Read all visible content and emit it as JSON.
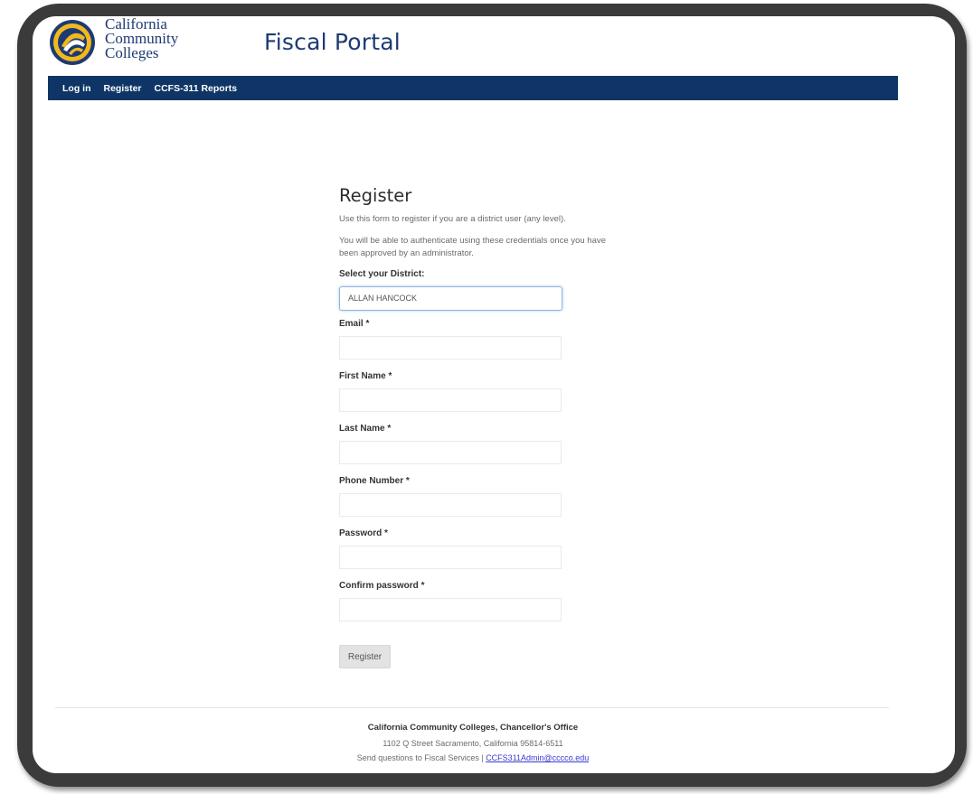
{
  "header": {
    "brand_lines": [
      "California",
      "Community",
      "Colleges"
    ],
    "portal_title": "Fiscal Portal"
  },
  "nav": {
    "items": [
      "Log in",
      "Register",
      "CCFS-311 Reports"
    ]
  },
  "form": {
    "title": "Register",
    "intro": "Use this form to register if you are a district user (any level).",
    "intro2": "You will be able to authenticate using these credentials once you have been approved by an administrator.",
    "district_label": "Select your District:",
    "district_value": "ALLAN HANCOCK",
    "fields": [
      {
        "label": "Email *"
      },
      {
        "label": "First Name *"
      },
      {
        "label": "Last Name *"
      },
      {
        "label": "Phone Number *"
      },
      {
        "label": "Password *"
      },
      {
        "label": "Confirm password *"
      }
    ],
    "submit_label": "Register"
  },
  "footer": {
    "org": "California Community Colleges, Chancellor's Office",
    "address": "1102 Q Street Sacramento, California 95814-6511",
    "questions": "Send questions to Fiscal Services |",
    "email": "CCFS311Admin@cccco.edu"
  },
  "colors": {
    "navbar": "#0f3566",
    "brand_text": "#1d3b72",
    "frame": "#3b3b3b"
  },
  "icons": {
    "logo": "california-community-colleges-seal-icon"
  }
}
